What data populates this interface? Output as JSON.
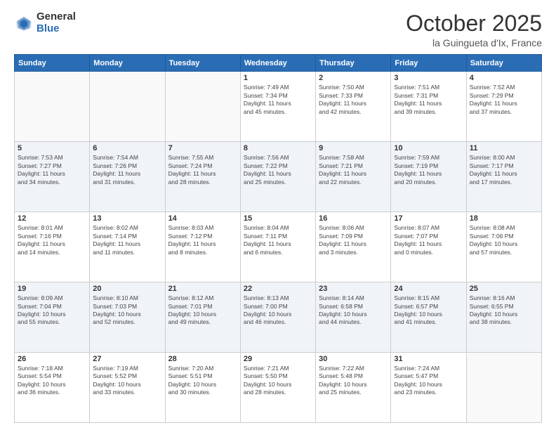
{
  "header": {
    "logo_general": "General",
    "logo_blue": "Blue",
    "month": "October 2025",
    "location": "la Guingueta d'Ix, France"
  },
  "weekdays": [
    "Sunday",
    "Monday",
    "Tuesday",
    "Wednesday",
    "Thursday",
    "Friday",
    "Saturday"
  ],
  "weeks": [
    [
      {
        "day": "",
        "info": ""
      },
      {
        "day": "",
        "info": ""
      },
      {
        "day": "",
        "info": ""
      },
      {
        "day": "1",
        "info": "Sunrise: 7:49 AM\nSunset: 7:34 PM\nDaylight: 11 hours\nand 45 minutes."
      },
      {
        "day": "2",
        "info": "Sunrise: 7:50 AM\nSunset: 7:33 PM\nDaylight: 11 hours\nand 42 minutes."
      },
      {
        "day": "3",
        "info": "Sunrise: 7:51 AM\nSunset: 7:31 PM\nDaylight: 11 hours\nand 39 minutes."
      },
      {
        "day": "4",
        "info": "Sunrise: 7:52 AM\nSunset: 7:29 PM\nDaylight: 11 hours\nand 37 minutes."
      }
    ],
    [
      {
        "day": "5",
        "info": "Sunrise: 7:53 AM\nSunset: 7:27 PM\nDaylight: 11 hours\nand 34 minutes."
      },
      {
        "day": "6",
        "info": "Sunrise: 7:54 AM\nSunset: 7:26 PM\nDaylight: 11 hours\nand 31 minutes."
      },
      {
        "day": "7",
        "info": "Sunrise: 7:55 AM\nSunset: 7:24 PM\nDaylight: 11 hours\nand 28 minutes."
      },
      {
        "day": "8",
        "info": "Sunrise: 7:56 AM\nSunset: 7:22 PM\nDaylight: 11 hours\nand 25 minutes."
      },
      {
        "day": "9",
        "info": "Sunrise: 7:58 AM\nSunset: 7:21 PM\nDaylight: 11 hours\nand 22 minutes."
      },
      {
        "day": "10",
        "info": "Sunrise: 7:59 AM\nSunset: 7:19 PM\nDaylight: 11 hours\nand 20 minutes."
      },
      {
        "day": "11",
        "info": "Sunrise: 8:00 AM\nSunset: 7:17 PM\nDaylight: 11 hours\nand 17 minutes."
      }
    ],
    [
      {
        "day": "12",
        "info": "Sunrise: 8:01 AM\nSunset: 7:16 PM\nDaylight: 11 hours\nand 14 minutes."
      },
      {
        "day": "13",
        "info": "Sunrise: 8:02 AM\nSunset: 7:14 PM\nDaylight: 11 hours\nand 11 minutes."
      },
      {
        "day": "14",
        "info": "Sunrise: 8:03 AM\nSunset: 7:12 PM\nDaylight: 11 hours\nand 8 minutes."
      },
      {
        "day": "15",
        "info": "Sunrise: 8:04 AM\nSunset: 7:11 PM\nDaylight: 11 hours\nand 6 minutes."
      },
      {
        "day": "16",
        "info": "Sunrise: 8:06 AM\nSunset: 7:09 PM\nDaylight: 11 hours\nand 3 minutes."
      },
      {
        "day": "17",
        "info": "Sunrise: 8:07 AM\nSunset: 7:07 PM\nDaylight: 11 hours\nand 0 minutes."
      },
      {
        "day": "18",
        "info": "Sunrise: 8:08 AM\nSunset: 7:06 PM\nDaylight: 10 hours\nand 57 minutes."
      }
    ],
    [
      {
        "day": "19",
        "info": "Sunrise: 8:09 AM\nSunset: 7:04 PM\nDaylight: 10 hours\nand 55 minutes."
      },
      {
        "day": "20",
        "info": "Sunrise: 8:10 AM\nSunset: 7:03 PM\nDaylight: 10 hours\nand 52 minutes."
      },
      {
        "day": "21",
        "info": "Sunrise: 8:12 AM\nSunset: 7:01 PM\nDaylight: 10 hours\nand 49 minutes."
      },
      {
        "day": "22",
        "info": "Sunrise: 8:13 AM\nSunset: 7:00 PM\nDaylight: 10 hours\nand 46 minutes."
      },
      {
        "day": "23",
        "info": "Sunrise: 8:14 AM\nSunset: 6:58 PM\nDaylight: 10 hours\nand 44 minutes."
      },
      {
        "day": "24",
        "info": "Sunrise: 8:15 AM\nSunset: 6:57 PM\nDaylight: 10 hours\nand 41 minutes."
      },
      {
        "day": "25",
        "info": "Sunrise: 8:16 AM\nSunset: 6:55 PM\nDaylight: 10 hours\nand 38 minutes."
      }
    ],
    [
      {
        "day": "26",
        "info": "Sunrise: 7:18 AM\nSunset: 5:54 PM\nDaylight: 10 hours\nand 36 minutes."
      },
      {
        "day": "27",
        "info": "Sunrise: 7:19 AM\nSunset: 5:52 PM\nDaylight: 10 hours\nand 33 minutes."
      },
      {
        "day": "28",
        "info": "Sunrise: 7:20 AM\nSunset: 5:51 PM\nDaylight: 10 hours\nand 30 minutes."
      },
      {
        "day": "29",
        "info": "Sunrise: 7:21 AM\nSunset: 5:50 PM\nDaylight: 10 hours\nand 28 minutes."
      },
      {
        "day": "30",
        "info": "Sunrise: 7:22 AM\nSunset: 5:48 PM\nDaylight: 10 hours\nand 25 minutes."
      },
      {
        "day": "31",
        "info": "Sunrise: 7:24 AM\nSunset: 5:47 PM\nDaylight: 10 hours\nand 23 minutes."
      },
      {
        "day": "",
        "info": ""
      }
    ]
  ]
}
